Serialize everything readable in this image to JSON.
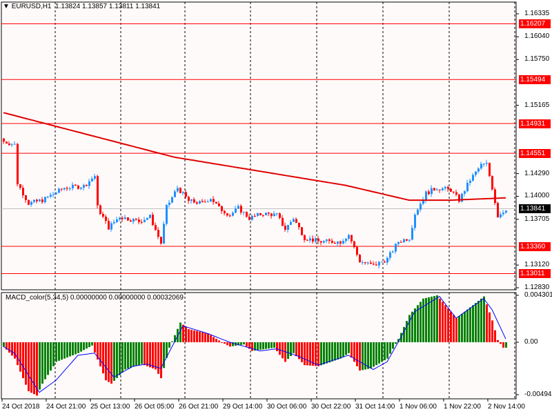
{
  "header": {
    "symbol": "EURUSD,H1",
    "ohlc": "1.13824 1.13857 1.13811 1.13841"
  },
  "macd": {
    "label": "MACD_color(5,34,5) 0.00000000 0.00000000 0.00032069",
    "axis": [
      "0.004301",
      "0.00",
      "-0.004941"
    ]
  },
  "price_axis": [
    "1.16335",
    "1.16040",
    "1.15750",
    "1.15165",
    "1.14290",
    "1.14000",
    "1.13705",
    "1.13120",
    "1.12830"
  ],
  "levels": [
    {
      "price": 1.16207,
      "label": "1.16207"
    },
    {
      "price": 1.15494,
      "label": "1.15494"
    },
    {
      "price": 1.14931,
      "label": "1.14931"
    },
    {
      "price": 1.14551,
      "label": "1.14551"
    },
    {
      "price": 1.1336,
      "label": "1.13360"
    },
    {
      "price": 1.13011,
      "label": "1.13011"
    }
  ],
  "current": {
    "price": 1.13841,
    "label": "1.13841"
  },
  "time_axis": [
    "24 Oct 2018",
    "24 Oct 21:00",
    "25 Oct 13:00",
    "26 Oct 05:00",
    "26 Oct 21:00",
    "29 Oct 14:00",
    "30 Oct 06:00",
    "30 Oct 22:00",
    "31 Oct 14:00",
    "1 Nov 06:00",
    "1 Nov 22:00",
    "2 Nov 14:00"
  ],
  "colors": {
    "bull": "#1e90ff",
    "bear": "#ff0000",
    "level": "#ff0000",
    "ma": "#e00000",
    "hist_up": "#008000",
    "hist_down": "#ff0000",
    "signal": "#0000ff",
    "bg": "#fffafa"
  },
  "chart_data": {
    "type": "candlestick",
    "bars": 183,
    "price_range": [
      1.1283,
      1.16335
    ],
    "close_keypoints": [
      [
        0,
        1.147
      ],
      [
        4,
        1.1466
      ],
      [
        5,
        1.1417
      ],
      [
        9,
        1.1391
      ],
      [
        14,
        1.1395
      ],
      [
        22,
        1.1411
      ],
      [
        29,
        1.1413
      ],
      [
        33,
        1.1426
      ],
      [
        34,
        1.1386
      ],
      [
        38,
        1.136
      ],
      [
        42,
        1.1374
      ],
      [
        49,
        1.1368
      ],
      [
        53,
        1.1374
      ],
      [
        57,
        1.134
      ],
      [
        59,
        1.1386
      ],
      [
        63,
        1.1411
      ],
      [
        67,
        1.1394
      ],
      [
        72,
        1.1391
      ],
      [
        75,
        1.1398
      ],
      [
        78,
        1.1385
      ],
      [
        82,
        1.1376
      ],
      [
        85,
        1.1385
      ],
      [
        89,
        1.1372
      ],
      [
        94,
        1.1378
      ],
      [
        99,
        1.1376
      ],
      [
        102,
        1.1358
      ],
      [
        105,
        1.1372
      ],
      [
        109,
        1.1347
      ],
      [
        114,
        1.1342
      ],
      [
        122,
        1.1342
      ],
      [
        125,
        1.1351
      ],
      [
        129,
        1.1317
      ],
      [
        134,
        1.1311
      ],
      [
        139,
        1.132
      ],
      [
        143,
        1.1342
      ],
      [
        147,
        1.1347
      ],
      [
        149,
        1.1378
      ],
      [
        153,
        1.1404
      ],
      [
        157,
        1.1411
      ],
      [
        162,
        1.1408
      ],
      [
        165,
        1.1395
      ],
      [
        169,
        1.1421
      ],
      [
        173,
        1.144
      ],
      [
        175,
        1.1441
      ],
      [
        177,
        1.1411
      ],
      [
        179,
        1.1375
      ],
      [
        182,
        1.1384
      ]
    ],
    "ma_keypoints": [
      [
        0,
        1.1507
      ],
      [
        62,
        1.145
      ],
      [
        124,
        1.1414
      ],
      [
        147,
        1.1395
      ],
      [
        162,
        1.1395
      ],
      [
        182,
        1.1398
      ]
    ],
    "macd_hist_keypoints": [
      [
        0,
        -0.0004
      ],
      [
        4,
        -0.0015
      ],
      [
        9,
        -0.0045
      ],
      [
        12,
        -0.0049
      ],
      [
        14,
        -0.0038
      ],
      [
        19,
        -0.0018
      ],
      [
        27,
        -0.001
      ],
      [
        32,
        -0.0003
      ],
      [
        37,
        -0.0035
      ],
      [
        39,
        -0.0038
      ],
      [
        44,
        -0.0025
      ],
      [
        50,
        -0.002
      ],
      [
        55,
        -0.0025
      ],
      [
        57,
        -0.0033
      ],
      [
        60,
        -0.0005
      ],
      [
        64,
        0.0018
      ],
      [
        67,
        0.0012
      ],
      [
        74,
        0.0008
      ],
      [
        79,
        0.0
      ],
      [
        82,
        -0.0004
      ],
      [
        87,
        -0.0002
      ],
      [
        90,
        -0.0008
      ],
      [
        98,
        -0.0005
      ],
      [
        102,
        -0.0018
      ],
      [
        105,
        -0.001
      ],
      [
        109,
        -0.0021
      ],
      [
        114,
        -0.0022
      ],
      [
        122,
        -0.0015
      ],
      [
        125,
        -0.001
      ],
      [
        129,
        -0.0026
      ],
      [
        133,
        -0.0024
      ],
      [
        139,
        -0.0015
      ],
      [
        143,
        0.0003
      ],
      [
        147,
        0.0025
      ],
      [
        152,
        0.004
      ],
      [
        157,
        0.0043
      ],
      [
        164,
        0.0022
      ],
      [
        169,
        0.0032
      ],
      [
        174,
        0.0042
      ],
      [
        177,
        0.002
      ],
      [
        179,
        0.0002
      ],
      [
        181,
        -0.0005
      ]
    ],
    "signal_keypoints": [
      [
        0,
        -0.0004
      ],
      [
        4,
        -0.001
      ],
      [
        13,
        -0.0046
      ],
      [
        19,
        -0.0035
      ],
      [
        27,
        -0.0012
      ],
      [
        33,
        -0.001
      ],
      [
        40,
        -0.0032
      ],
      [
        47,
        -0.0022
      ],
      [
        52,
        -0.002
      ],
      [
        57,
        -0.0024
      ],
      [
        65,
        0.0015
      ],
      [
        74,
        0.0008
      ],
      [
        82,
        0.0
      ],
      [
        93,
        -0.0008
      ],
      [
        99,
        -0.0006
      ],
      [
        107,
        -0.0013
      ],
      [
        114,
        -0.0021
      ],
      [
        125,
        -0.0012
      ],
      [
        134,
        -0.0025
      ],
      [
        139,
        -0.0018
      ],
      [
        143,
        0.0
      ],
      [
        149,
        0.0028
      ],
      [
        158,
        0.0042
      ],
      [
        164,
        0.0022
      ],
      [
        174,
        0.004
      ],
      [
        177,
        0.003
      ],
      [
        182,
        0.0003
      ]
    ],
    "macd_range": [
      -0.004941,
      0.004301
    ]
  }
}
